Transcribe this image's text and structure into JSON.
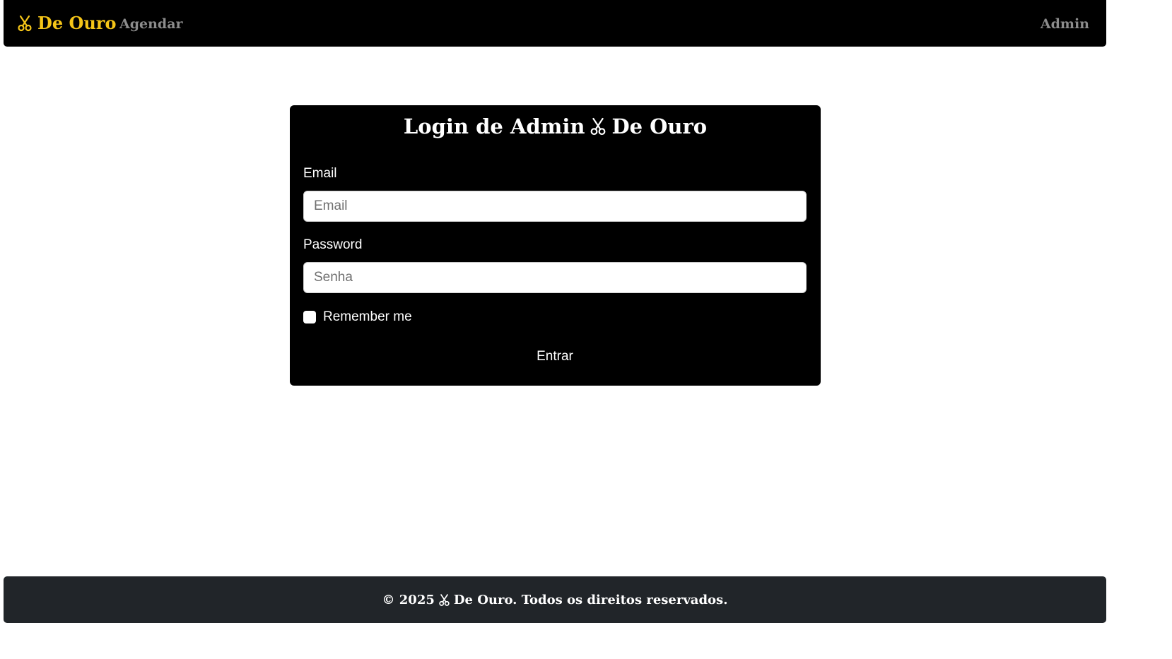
{
  "nav": {
    "brand": "De Ouro",
    "brand_icon": "scissors-icon",
    "agendar": "Agendar",
    "admin": "Admin"
  },
  "card": {
    "title_prefix": "Login de Admin",
    "title_suffix": "De Ouro",
    "email_label": "Email",
    "email_placeholder": "Email",
    "password_label": "Password",
    "password_placeholder": "Senha",
    "remember_label": "Remember me",
    "submit_label": "Entrar"
  },
  "footer": {
    "prefix": "© 2025",
    "suffix": "De Ouro. Todos os direitos reservados."
  },
  "colors": {
    "brand": "#f5c518",
    "navbar_bg": "#000000",
    "card_bg": "#000000",
    "footer_bg": "#212529",
    "nav_link": "#8c8c8c"
  }
}
